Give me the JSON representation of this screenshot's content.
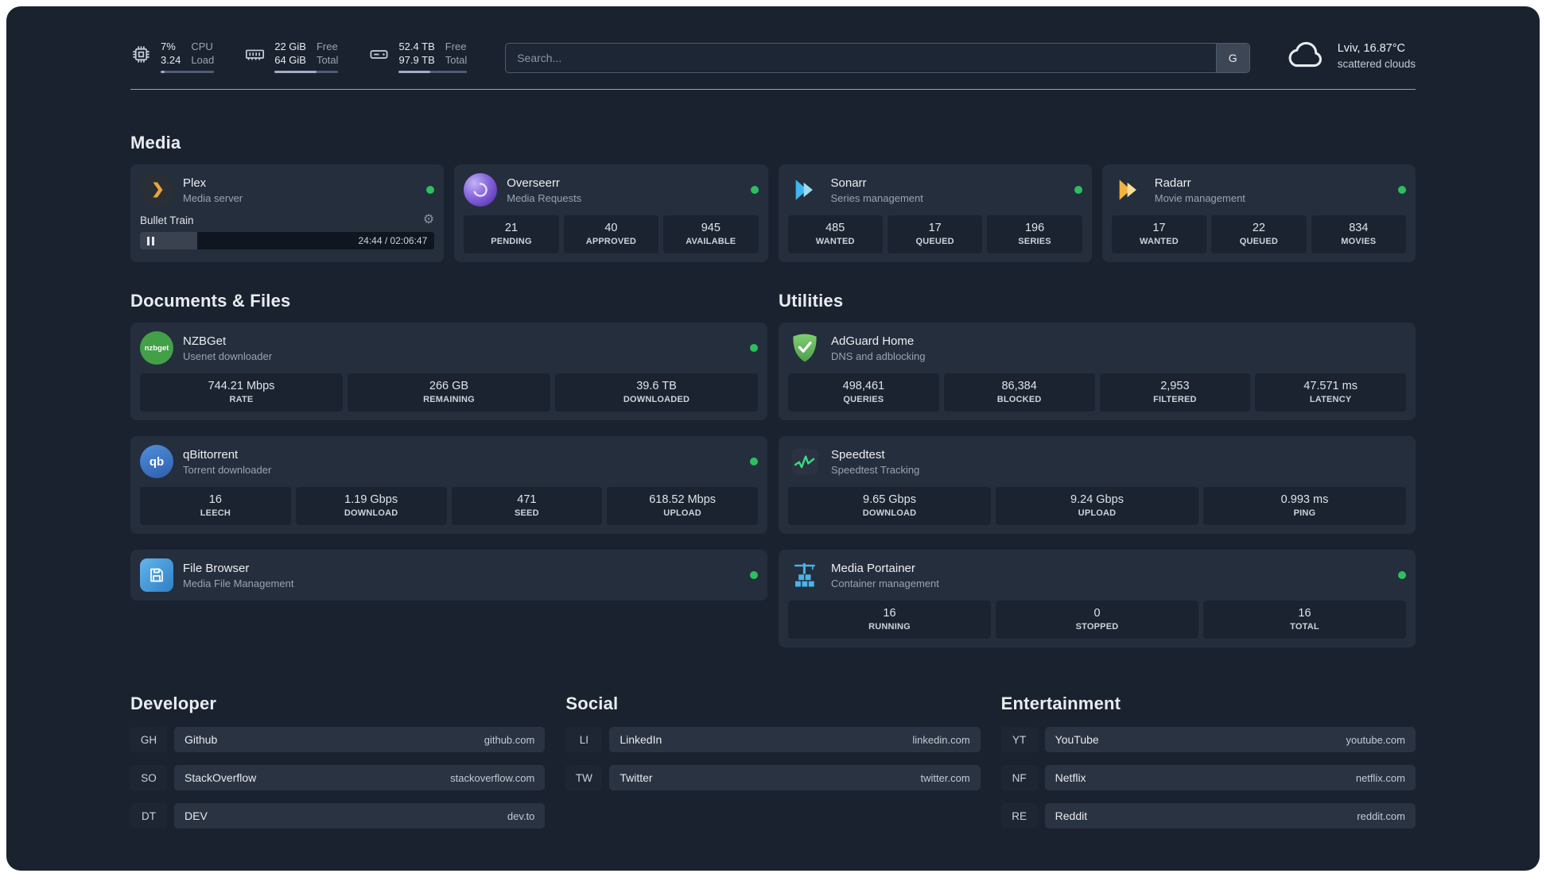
{
  "colors": {
    "background": "#1a2230",
    "card": "#252e3d",
    "status_online": "#2dbe60"
  },
  "icons": {
    "gear": "⚙",
    "nzbget_label": "nzbget",
    "qbittorrent_label": "qb"
  },
  "topbar": {
    "cpu": {
      "percent": "7%",
      "load": "3.24",
      "label_top": "CPU",
      "label_bottom": "Load",
      "bar_percent": 7
    },
    "memory": {
      "free": "22 GiB",
      "total": "64 GiB",
      "label_top": "Free",
      "label_bottom": "Total",
      "bar_percent": 66
    },
    "disk": {
      "free": "52.4 TB",
      "total": "97.9 TB",
      "label_top": "Free",
      "label_bottom": "Total",
      "bar_percent": 46
    },
    "search": {
      "placeholder": "Search...",
      "provider_button": "G"
    },
    "weather": {
      "location": "Lviv, 16.87°C",
      "condition": "scattered clouds"
    }
  },
  "media": {
    "heading": "Media",
    "plex": {
      "name": "Plex",
      "subtitle": "Media server",
      "now_playing": "Bullet Train",
      "time": "24:44 / 02:06:47",
      "progress_percent": 19.5
    },
    "overseerr": {
      "name": "Overseerr",
      "subtitle": "Media Requests",
      "stats": [
        {
          "value": "21",
          "label": "PENDING"
        },
        {
          "value": "40",
          "label": "APPROVED"
        },
        {
          "value": "945",
          "label": "AVAILABLE"
        }
      ]
    },
    "sonarr": {
      "name": "Sonarr",
      "subtitle": "Series management",
      "stats": [
        {
          "value": "485",
          "label": "WANTED"
        },
        {
          "value": "17",
          "label": "QUEUED"
        },
        {
          "value": "196",
          "label": "SERIES"
        }
      ]
    },
    "radarr": {
      "name": "Radarr",
      "subtitle": "Movie management",
      "stats": [
        {
          "value": "17",
          "label": "WANTED"
        },
        {
          "value": "22",
          "label": "QUEUED"
        },
        {
          "value": "834",
          "label": "MOVIES"
        }
      ]
    }
  },
  "documents": {
    "heading": "Documents & Files",
    "nzbget": {
      "name": "NZBGet",
      "subtitle": "Usenet downloader",
      "stats": [
        {
          "value": "744.21 Mbps",
          "label": "RATE"
        },
        {
          "value": "266 GB",
          "label": "REMAINING"
        },
        {
          "value": "39.6 TB",
          "label": "DOWNLOADED"
        }
      ]
    },
    "qbittorrent": {
      "name": "qBittorrent",
      "subtitle": "Torrent downloader",
      "stats": [
        {
          "value": "16",
          "label": "LEECH"
        },
        {
          "value": "1.19 Gbps",
          "label": "DOWNLOAD"
        },
        {
          "value": "471",
          "label": "SEED"
        },
        {
          "value": "618.52 Mbps",
          "label": "UPLOAD"
        }
      ]
    },
    "filebrowser": {
      "name": "File Browser",
      "subtitle": "Media File Management"
    }
  },
  "utilities": {
    "heading": "Utilities",
    "adguard": {
      "name": "AdGuard Home",
      "subtitle": "DNS and adblocking",
      "stats": [
        {
          "value": "498,461",
          "label": "QUERIES"
        },
        {
          "value": "86,384",
          "label": "BLOCKED"
        },
        {
          "value": "2,953",
          "label": "FILTERED"
        },
        {
          "value": "47.571 ms",
          "label": "LATENCY"
        }
      ]
    },
    "speedtest": {
      "name": "Speedtest",
      "subtitle": "Speedtest Tracking",
      "stats": [
        {
          "value": "9.65 Gbps",
          "label": "DOWNLOAD"
        },
        {
          "value": "9.24 Gbps",
          "label": "UPLOAD"
        },
        {
          "value": "0.993 ms",
          "label": "PING"
        }
      ]
    },
    "portainer": {
      "name": "Media Portainer",
      "subtitle": "Container management",
      "stats": [
        {
          "value": "16",
          "label": "RUNNING"
        },
        {
          "value": "0",
          "label": "STOPPED"
        },
        {
          "value": "16",
          "label": "TOTAL"
        }
      ]
    }
  },
  "bookmarks": {
    "groups": [
      {
        "heading": "Developer",
        "items": [
          {
            "abbr": "GH",
            "name": "Github",
            "url": "github.com"
          },
          {
            "abbr": "SO",
            "name": "StackOverflow",
            "url": "stackoverflow.com"
          },
          {
            "abbr": "DT",
            "name": "DEV",
            "url": "dev.to"
          }
        ]
      },
      {
        "heading": "Social",
        "items": [
          {
            "abbr": "LI",
            "name": "LinkedIn",
            "url": "linkedin.com"
          },
          {
            "abbr": "TW",
            "name": "Twitter",
            "url": "twitter.com"
          }
        ]
      },
      {
        "heading": "Entertainment",
        "items": [
          {
            "abbr": "YT",
            "name": "YouTube",
            "url": "youtube.com"
          },
          {
            "abbr": "NF",
            "name": "Netflix",
            "url": "netflix.com"
          },
          {
            "abbr": "RE",
            "name": "Reddit",
            "url": "reddit.com"
          }
        ]
      }
    ]
  }
}
